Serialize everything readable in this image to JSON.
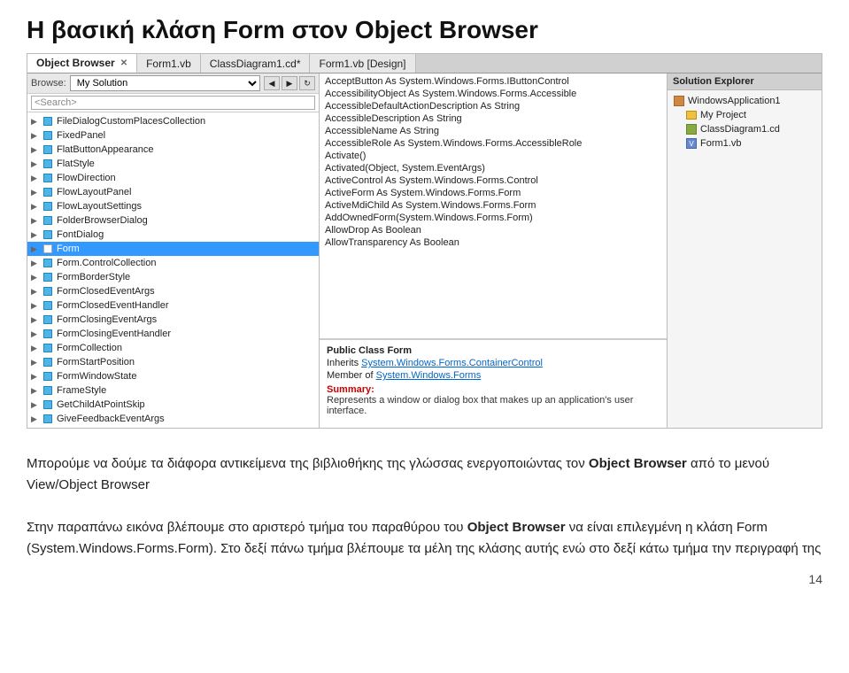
{
  "page": {
    "title": "Η βασική κλάση Form στον Object Browser"
  },
  "tabs": [
    {
      "label": "Object Browser",
      "active": true,
      "closable": true
    },
    {
      "label": "Form1.vb",
      "active": false,
      "closable": false
    },
    {
      "label": "ClassDiagram1.cd*",
      "active": false,
      "closable": false
    },
    {
      "label": "Form1.vb [Design]",
      "active": false,
      "closable": false
    }
  ],
  "browse": {
    "label": "Browse:",
    "value": "My Solution",
    "search_placeholder": "<Search>"
  },
  "tree_items": [
    {
      "indent": false,
      "arrow": "▶",
      "label": "FileDialogCustomPlacesCollection"
    },
    {
      "indent": false,
      "arrow": "▶",
      "label": "FixedPanel"
    },
    {
      "indent": false,
      "arrow": "▶",
      "label": "FlatButtonAppearance"
    },
    {
      "indent": false,
      "arrow": "▶",
      "label": "FlatStyle"
    },
    {
      "indent": false,
      "arrow": "▶",
      "label": "FlowDirection"
    },
    {
      "indent": false,
      "arrow": "▶",
      "label": "FlowLayoutPanel"
    },
    {
      "indent": false,
      "arrow": "▶",
      "label": "FlowLayoutSettings"
    },
    {
      "indent": false,
      "arrow": "▶",
      "label": "FolderBrowserDialog"
    },
    {
      "indent": false,
      "arrow": "▶",
      "label": "FontDialog"
    },
    {
      "indent": false,
      "arrow": "▶",
      "label": "Form",
      "selected": true
    },
    {
      "indent": false,
      "arrow": "▶",
      "label": "Form.ControlCollection"
    },
    {
      "indent": false,
      "arrow": "▶",
      "label": "FormBorderStyle"
    },
    {
      "indent": false,
      "arrow": "▶",
      "label": "FormClosedEventArgs"
    },
    {
      "indent": false,
      "arrow": "▶",
      "label": "FormClosedEventHandler"
    },
    {
      "indent": false,
      "arrow": "▶",
      "label": "FormClosingEventArgs"
    },
    {
      "indent": false,
      "arrow": "▶",
      "label": "FormClosingEventHandler"
    },
    {
      "indent": false,
      "arrow": "▶",
      "label": "FormCollection"
    },
    {
      "indent": false,
      "arrow": "▶",
      "label": "FormStartPosition"
    },
    {
      "indent": false,
      "arrow": "▶",
      "label": "FormWindowState"
    },
    {
      "indent": false,
      "arrow": "▶",
      "label": "FrameStyle"
    },
    {
      "indent": false,
      "arrow": "▶",
      "label": "GetChildAtPointSkip"
    },
    {
      "indent": false,
      "arrow": "▶",
      "label": "GiveFeedbackEventArgs"
    }
  ],
  "members": [
    "AcceptButton As System.Windows.Forms.IButtonControl",
    "AccessibilityObject As System.Windows.Forms.Accessible",
    "AccessibleDefaultActionDescription As String",
    "AccessibleDescription As String",
    "AccessibleName As String",
    "AccessibleRole As System.Windows.Forms.AccessibleRole",
    "Activate()",
    "Activated(Object, System.EventArgs)",
    "ActiveControl As System.Windows.Forms.Control",
    "ActiveForm As System.Windows.Forms.Form",
    "ActiveMdiChild As System.Windows.Forms.Form",
    "AddOwnedForm(System.Windows.Forms.Form)",
    "AllowDrop As Boolean",
    "AllowTransparency As Boolean"
  ],
  "description": {
    "public_class": "Public Class Form",
    "inherits": "Inherits",
    "base_class": "System.Windows.Forms.ContainerControl",
    "member_of_label": "Member of",
    "member_of": "System.Windows.Forms",
    "summary_label": "Summary:",
    "summary_text": "Represents a window or dialog box that makes up an application's user interface."
  },
  "solution_explorer": {
    "header": "Solution Explorer",
    "items": [
      {
        "label": "WindowsApplication1",
        "type": "app",
        "indent": 0
      },
      {
        "label": "My Project",
        "type": "folder",
        "indent": 1
      },
      {
        "label": "ClassDiagram1.cd",
        "type": "cd",
        "indent": 1
      },
      {
        "label": "Form1.vb",
        "type": "vb",
        "indent": 1
      }
    ]
  },
  "body_text": {
    "paragraph1": "Μπορούμε να δούμε τα διάφορα αντικείμενα της βιβλιοθήκης της γλώσσας ενεργοποιώντας τον Object Browser από το μενού View/Object Browser",
    "paragraph2_prefix": "Στην παραπάνω εικόνα βλέπουμε στο αριστερό τμήμα του παραθύρου του ",
    "paragraph2_bold": "Object Browser",
    "paragraph2_suffix": " να είναι επιλεγμένη η κλάση Form (System.Windows.Forms.Form). Στο δεξί πάνω τμήμα βλέπουμε τα μέλη της κλάσης αυτής ενώ στο δεξί κάτω τμήμα την περιγραφή της"
  },
  "page_number": "14"
}
